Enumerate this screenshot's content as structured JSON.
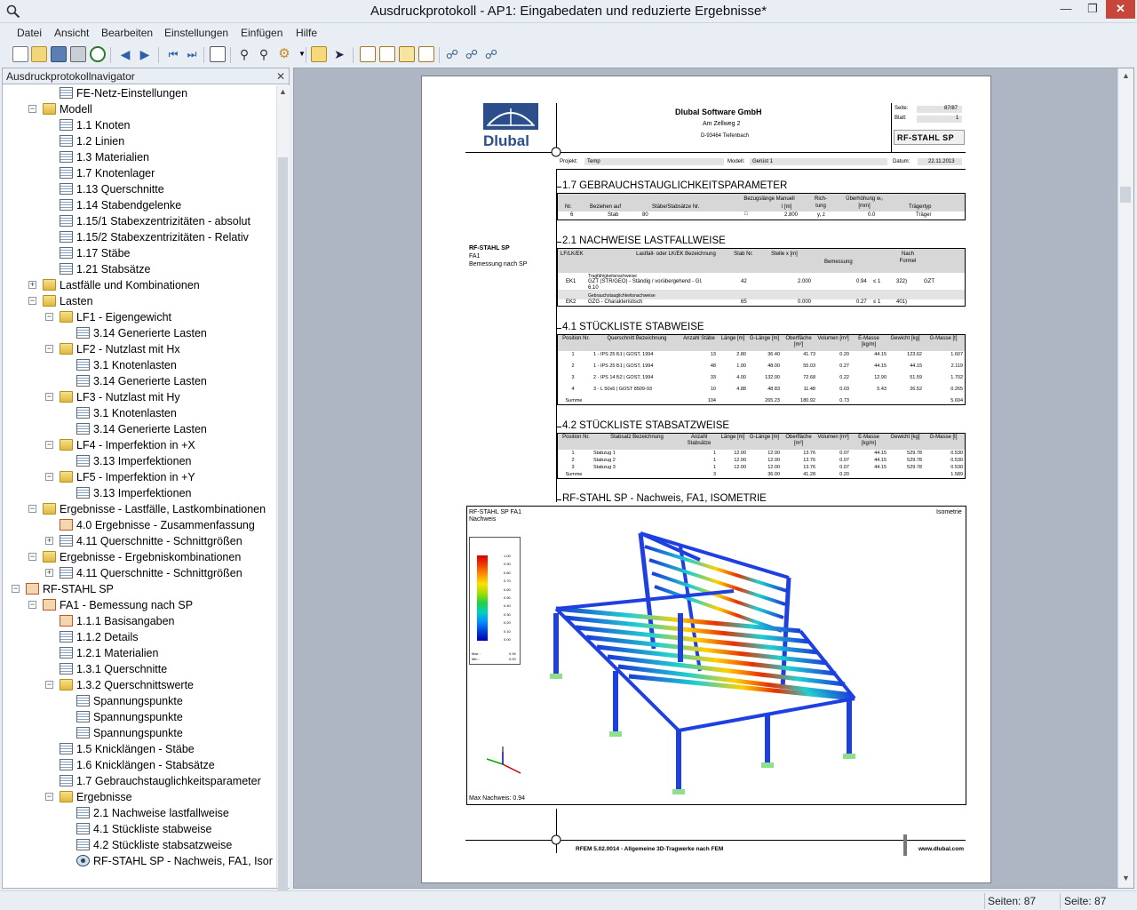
{
  "window": {
    "title": "Ausdruckprotokoll - AP1: Eingabedaten und reduzierte Ergebnisse*"
  },
  "menu": [
    "Datei",
    "Ansicht",
    "Bearbeiten",
    "Einstellungen",
    "Einfügen",
    "Hilfe"
  ],
  "navigator": {
    "title": "Ausdruckprotokollnavigator",
    "items": [
      {
        "label": "FE-Netz-Einstellungen",
        "level": 3,
        "icon": "doc"
      },
      {
        "label": "Modell",
        "level": 2,
        "icon": "folder",
        "expanded": true
      },
      {
        "label": "1.1 Knoten",
        "level": 3,
        "icon": "doc"
      },
      {
        "label": "1.2 Linien",
        "level": 3,
        "icon": "doc"
      },
      {
        "label": "1.3 Materialien",
        "level": 3,
        "icon": "doc"
      },
      {
        "label": "1.7 Knotenlager",
        "level": 3,
        "icon": "doc"
      },
      {
        "label": "1.13 Querschnitte",
        "level": 3,
        "icon": "doc"
      },
      {
        "label": "1.14 Stabendgelenke",
        "level": 3,
        "icon": "doc"
      },
      {
        "label": "1.15/1 Stabexzentrizitäten - absolut",
        "level": 3,
        "icon": "doc"
      },
      {
        "label": "1.15/2 Stabexzentrizitäten - Relativ",
        "level": 3,
        "icon": "doc"
      },
      {
        "label": "1.17 Stäbe",
        "level": 3,
        "icon": "doc"
      },
      {
        "label": "1.21 Stabsätze",
        "level": 3,
        "icon": "doc"
      },
      {
        "label": "Lastfälle und Kombinationen",
        "level": 2,
        "icon": "folder",
        "expanded": false
      },
      {
        "label": "Lasten",
        "level": 2,
        "icon": "folder",
        "expanded": true
      },
      {
        "label": "LF1 - Eigengewicht",
        "level": 3,
        "icon": "folder",
        "expanded": true
      },
      {
        "label": "3.14 Generierte Lasten",
        "level": 4,
        "icon": "doc"
      },
      {
        "label": "LF2 - Nutzlast mit Hx",
        "level": 3,
        "icon": "folder",
        "expanded": true
      },
      {
        "label": "3.1 Knotenlasten",
        "level": 4,
        "icon": "doc"
      },
      {
        "label": "3.14 Generierte Lasten",
        "level": 4,
        "icon": "doc"
      },
      {
        "label": "LF3 - Nutzlast mit Hy",
        "level": 3,
        "icon": "folder",
        "expanded": true
      },
      {
        "label": "3.1 Knotenlasten",
        "level": 4,
        "icon": "doc"
      },
      {
        "label": "3.14 Generierte Lasten",
        "level": 4,
        "icon": "doc"
      },
      {
        "label": "LF4 - Imperfektion in +X",
        "level": 3,
        "icon": "folder",
        "expanded": true
      },
      {
        "label": "3.13 Imperfektionen",
        "level": 4,
        "icon": "doc"
      },
      {
        "label": "LF5 - Imperfektion in +Y",
        "level": 3,
        "icon": "folder",
        "expanded": true
      },
      {
        "label": "3.13 Imperfektionen",
        "level": 4,
        "icon": "doc"
      },
      {
        "label": "Ergebnisse - Lastfälle, Lastkombinationen",
        "level": 2,
        "icon": "folder",
        "expanded": true
      },
      {
        "label": "4.0 Ergebnisse - Zusammenfassung",
        "level": 3,
        "icon": "special"
      },
      {
        "label": "4.11 Querschnitte - Schnittgrößen",
        "level": 3,
        "icon": "doc",
        "expanded": false
      },
      {
        "label": "Ergebnisse - Ergebniskombinationen",
        "level": 2,
        "icon": "folder",
        "expanded": true
      },
      {
        "label": "4.11 Querschnitte - Schnittgrößen",
        "level": 3,
        "icon": "doc",
        "expanded": false
      },
      {
        "label": "RF-STAHL SP",
        "level": 1,
        "icon": "special",
        "expanded": true
      },
      {
        "label": "FA1 - Bemessung nach SP",
        "level": 2,
        "icon": "special",
        "expanded": true
      },
      {
        "label": "1.1.1 Basisangaben",
        "level": 3,
        "icon": "special"
      },
      {
        "label": "1.1.2 Details",
        "level": 3,
        "icon": "doc"
      },
      {
        "label": "1.2.1 Materialien",
        "level": 3,
        "icon": "doc"
      },
      {
        "label": "1.3.1 Querschnitte",
        "level": 3,
        "icon": "doc"
      },
      {
        "label": "1.3.2 Querschnittswerte",
        "level": 3,
        "icon": "folder",
        "expanded": true
      },
      {
        "label": "Spannungspunkte",
        "level": 4,
        "icon": "doc"
      },
      {
        "label": "Spannungspunkte",
        "level": 4,
        "icon": "doc"
      },
      {
        "label": "Spannungspunkte",
        "level": 4,
        "icon": "doc"
      },
      {
        "label": "1.5 Knicklängen - Stäbe",
        "level": 3,
        "icon": "doc"
      },
      {
        "label": "1.6 Knicklängen - Stabsätze",
        "level": 3,
        "icon": "doc"
      },
      {
        "label": "1.7 Gebrauchstauglichkeitsparameter",
        "level": 3,
        "icon": "doc"
      },
      {
        "label": "Ergebnisse",
        "level": 3,
        "icon": "folder",
        "expanded": true
      },
      {
        "label": "2.1 Nachweise lastfallweise",
        "level": 4,
        "icon": "doc"
      },
      {
        "label": "4.1 Stückliste stabweise",
        "level": 4,
        "icon": "doc"
      },
      {
        "label": "4.2 Stückliste stabsatzweise",
        "level": 4,
        "icon": "doc"
      },
      {
        "label": "RF-STAHL SP -  Nachweis, FA1, Isor",
        "level": 4,
        "icon": "eye"
      }
    ]
  },
  "page": {
    "company": "Dlubal Software GmbH",
    "street": "Am Zellweg 2",
    "city": "D-93464 Tiefenbach",
    "logo": "Dlubal",
    "seite_label": "Seite:",
    "seite_value": "87/87",
    "blatt_label": "Blatt:",
    "blatt_value": "1",
    "module": "RF-STAHL SP",
    "projekt_label": "Projekt:",
    "projekt_value": "Temp",
    "modell_label": "Modell:",
    "modell_value": "Gerüst 1",
    "datum_label": "Datum:",
    "datum_value": "22.11.2013",
    "side_title": "RF-STAHL SP",
    "side_case": "FA1",
    "side_desc": "Bemessung nach SP",
    "s1": "1.7 GEBRAUCHSTAUGLICHKEITSPARAMETER",
    "s2": "2.1 NACHWEISE LASTFALLWEISE",
    "s3": "4.1 STÜCKLISTE STABWEISE",
    "s4": "4.2 STÜCKLISTE STABSATZWEISE",
    "s5": "RF-STAHL SP -  Nachweis, FA1, ISOMETRIE",
    "t1": {
      "headers": [
        "Nr.",
        "Beziehen auf",
        "Stäbe/Stabsätze Nr.",
        "Bezugslänge Manuell",
        "l [m]",
        "Rich-tung",
        "Überhöhung w₀ [mm]",
        "Trägertyp"
      ],
      "row": [
        "6",
        "Stab",
        "80",
        "□",
        "2.800",
        "y, z",
        "0.0",
        "Träger"
      ]
    },
    "t2": {
      "headers": [
        "LF/LK/EK",
        "Lastfall- oder LK/EK Bezeichnung",
        "Stab Nr.",
        "Stelle x [m]",
        "Bemessung",
        "Nach Formel"
      ],
      "group1": "Tragfähigkeitsnachweise",
      "row1": [
        "EK1",
        "GZT (STR/GEO) - Ständig / vorübergehend - Gl. 6.10",
        "42",
        "2.000",
        "0.94",
        "≤ 1",
        "322)",
        "GZT"
      ],
      "group2": "Gebrauchstauglichkeitsnachweise",
      "row2": [
        "EK2",
        "GZG - Charakteristisch",
        "65",
        "0.000",
        "0.27",
        "≤ 1",
        "401)",
        ""
      ]
    },
    "t3": {
      "headers": [
        "Position Nr.",
        "Querschnitt Bezeichnung",
        "Anzahl Stäbe",
        "Länge [m]",
        "G-Länge [m]",
        "Oberfläche [m²]",
        "Volumen [m³]",
        "E-Masse [kg/m]",
        "Gewicht [kg]",
        "G-Masse [t]"
      ],
      "rows": [
        [
          "1",
          "1 - IPS 25 Б1 | GOST, 1994",
          "13",
          "2.80",
          "36.40",
          "41.73",
          "0.20",
          "44.15",
          "123.62",
          "1.607"
        ],
        [
          "2",
          "1 - IPS 25 Б1 | GOST, 1994",
          "48",
          "1.00",
          "48.00",
          "55.03",
          "0.27",
          "44.15",
          "44.15",
          "2.119"
        ],
        [
          "3",
          "2 - IPS 14 Б2 | GOST, 1994",
          "33",
          "4.00",
          "132.00",
          "72.68",
          "0.22",
          "12.90",
          "51.59",
          "1.702"
        ],
        [
          "4",
          "3 - L 50x6 | GOST 8509-93",
          "10",
          "4.88",
          "48.83",
          "11.48",
          "0.03",
          "5.43",
          "26.52",
          "0.265"
        ],
        [
          "Summe",
          "",
          "104",
          "",
          "265.23",
          "180.92",
          "0.73",
          "",
          "",
          "5.694"
        ]
      ]
    },
    "t4": {
      "headers": [
        "Position Nr.",
        "Stabsatz Bezeichnung",
        "Anzahl Stabsätze",
        "Länge [m]",
        "G-Länge [m]",
        "Oberfläche [m²]",
        "Volumen [m³]",
        "E-Masse [kg/m]",
        "Gewicht [kg]",
        "G-Masse [t]"
      ],
      "rows": [
        [
          "1",
          "Stabzug 1",
          "1",
          "12.00",
          "12.00",
          "13.76",
          "0.07",
          "44.15",
          "529.78",
          "0.530"
        ],
        [
          "2",
          "Stabzug 2",
          "1",
          "12.00",
          "12.00",
          "13.76",
          "0.07",
          "44.15",
          "529.78",
          "0.530"
        ],
        [
          "3",
          "Stabzug 3",
          "1",
          "12.00",
          "12.00",
          "13.76",
          "0.07",
          "44.15",
          "529.78",
          "0.530"
        ],
        [
          "Summe",
          "",
          "3",
          "",
          "36.00",
          "41.28",
          "0.20",
          "",
          "",
          "1.589"
        ]
      ]
    },
    "iso": {
      "title1": "RF-STAHL SP FA1",
      "title2": "Nachweis",
      "view": "Isometrie",
      "max": "Max Nachweis: 0.94",
      "legend_values": [
        "1.00",
        "0.90",
        "0.80",
        "0.70",
        "0.60",
        "0.50",
        "0.40",
        "0.30",
        "0.20",
        "0.10",
        "0.00"
      ],
      "legend_max_label": "Max :",
      "legend_max": "0.94",
      "legend_min_label": "Min :",
      "legend_min": "0.00"
    },
    "footer": {
      "left": "RFEM 5.02.0014 - Allgemeine 3D-Tragwerke nach FEM",
      "right": "www.dlubal.com"
    }
  },
  "status": {
    "pages": "Seiten: 87",
    "page": "Seite: 87"
  }
}
